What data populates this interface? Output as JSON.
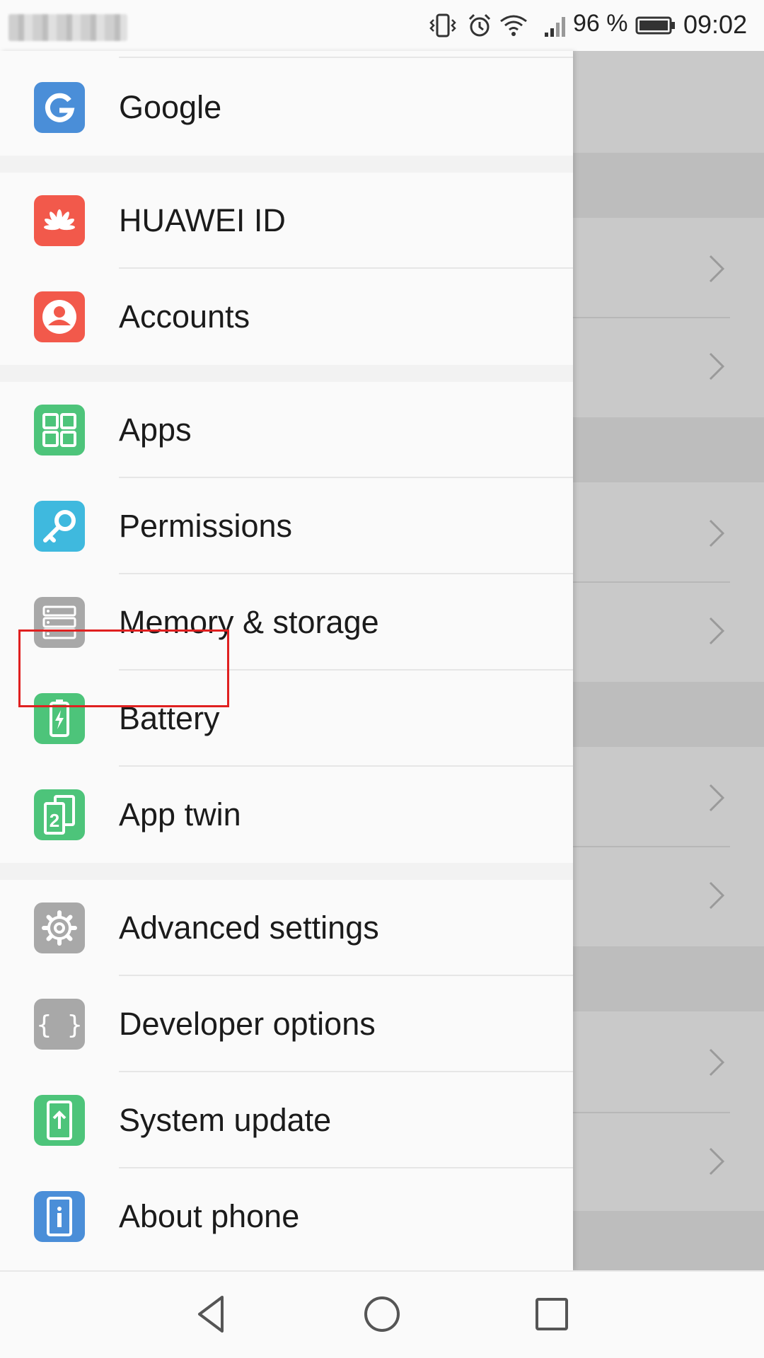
{
  "status_bar": {
    "battery_percent": "96 %",
    "time": "09:02"
  },
  "colors": {
    "google": "#4a8ed8",
    "huawei_id": "#f2594b",
    "accounts": "#f2594b",
    "apps": "#4dc47a",
    "permissions": "#3fb9de",
    "memory_storage": "#a8a8a8",
    "battery": "#4dc47a",
    "app_twin": "#4dc47a",
    "advanced_settings": "#a8a8a8",
    "developer_options": "#a8a8a8",
    "system_update": "#4dc47a",
    "about_phone": "#4a8ed8",
    "highlight": "#e02020"
  },
  "menu": {
    "items": [
      {
        "label": "Google",
        "icon": "google-icon"
      },
      {
        "label": "HUAWEI ID",
        "icon": "huawei-icon"
      },
      {
        "label": "Accounts",
        "icon": "account-icon"
      },
      {
        "label": "Apps",
        "icon": "apps-grid-icon"
      },
      {
        "label": "Permissions",
        "icon": "key-icon"
      },
      {
        "label": "Memory & storage",
        "icon": "storage-icon"
      },
      {
        "label": "Battery",
        "icon": "battery-icon"
      },
      {
        "label": "App twin",
        "icon": "app-twin-icon"
      },
      {
        "label": "Advanced settings",
        "icon": "gear-icon"
      },
      {
        "label": "Developer options",
        "icon": "braces-icon"
      },
      {
        "label": "System update",
        "icon": "system-update-icon"
      },
      {
        "label": "About phone",
        "icon": "info-icon"
      }
    ]
  },
  "highlighted_item": "Battery",
  "nav_bar": {
    "buttons": [
      "back-icon",
      "home-icon",
      "recent-apps-icon"
    ]
  }
}
